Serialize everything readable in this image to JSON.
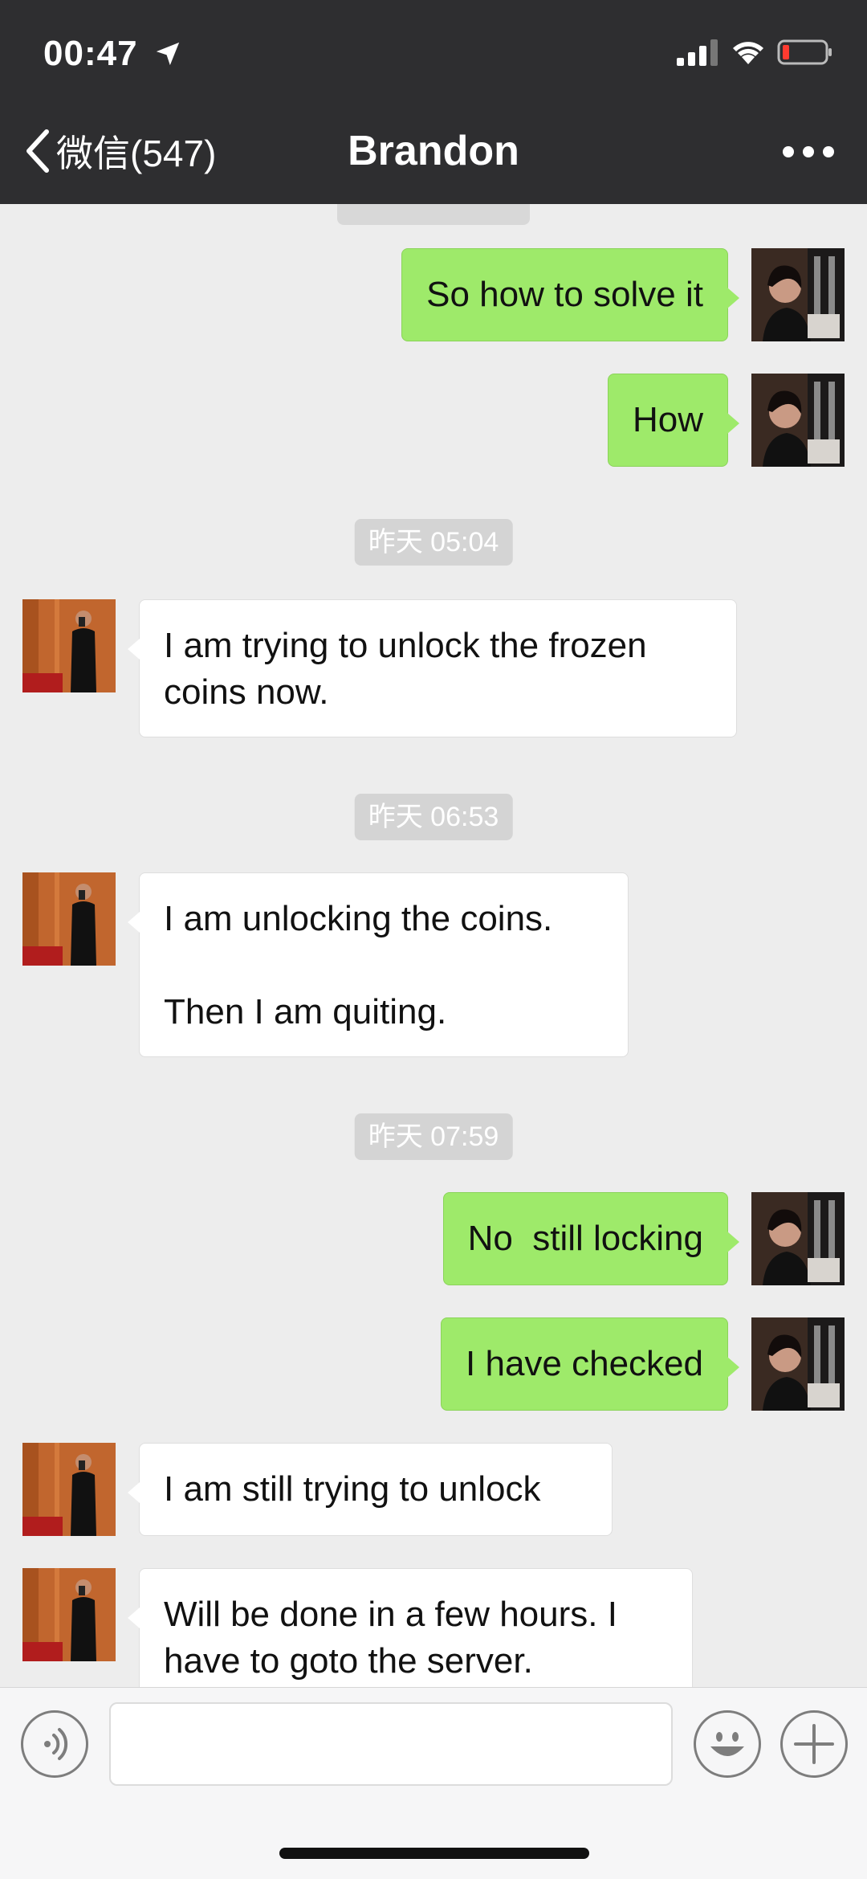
{
  "status_bar": {
    "time": "00:47"
  },
  "nav": {
    "back_label": "微信(547)",
    "title": "Brandon"
  },
  "messages": [
    {
      "from": "me",
      "text": "So how to solve it"
    },
    {
      "from": "me",
      "text": "How"
    },
    {
      "timestamp": "昨天 05:04"
    },
    {
      "from": "them",
      "text": "I am trying to unlock the frozen\ncoins now."
    },
    {
      "timestamp": "昨天 06:53"
    },
    {
      "from": "them",
      "text": "I am unlocking the coins.\n\nThen I am quiting."
    },
    {
      "timestamp": "昨天 07:59"
    },
    {
      "from": "me",
      "text": "No  still locking"
    },
    {
      "from": "me",
      "text": "I have checked"
    },
    {
      "from": "them",
      "text": "I am still trying to unlock"
    },
    {
      "from": "them",
      "text": "Will be done in a few hours. I\nhave to goto the server."
    }
  ],
  "colors": {
    "header_bg": "#2e2e30",
    "chat_bg": "#ededed",
    "my_bubble": "#9eea6a",
    "their_bubble": "#ffffff",
    "time_pill": "#d4d4d4"
  }
}
